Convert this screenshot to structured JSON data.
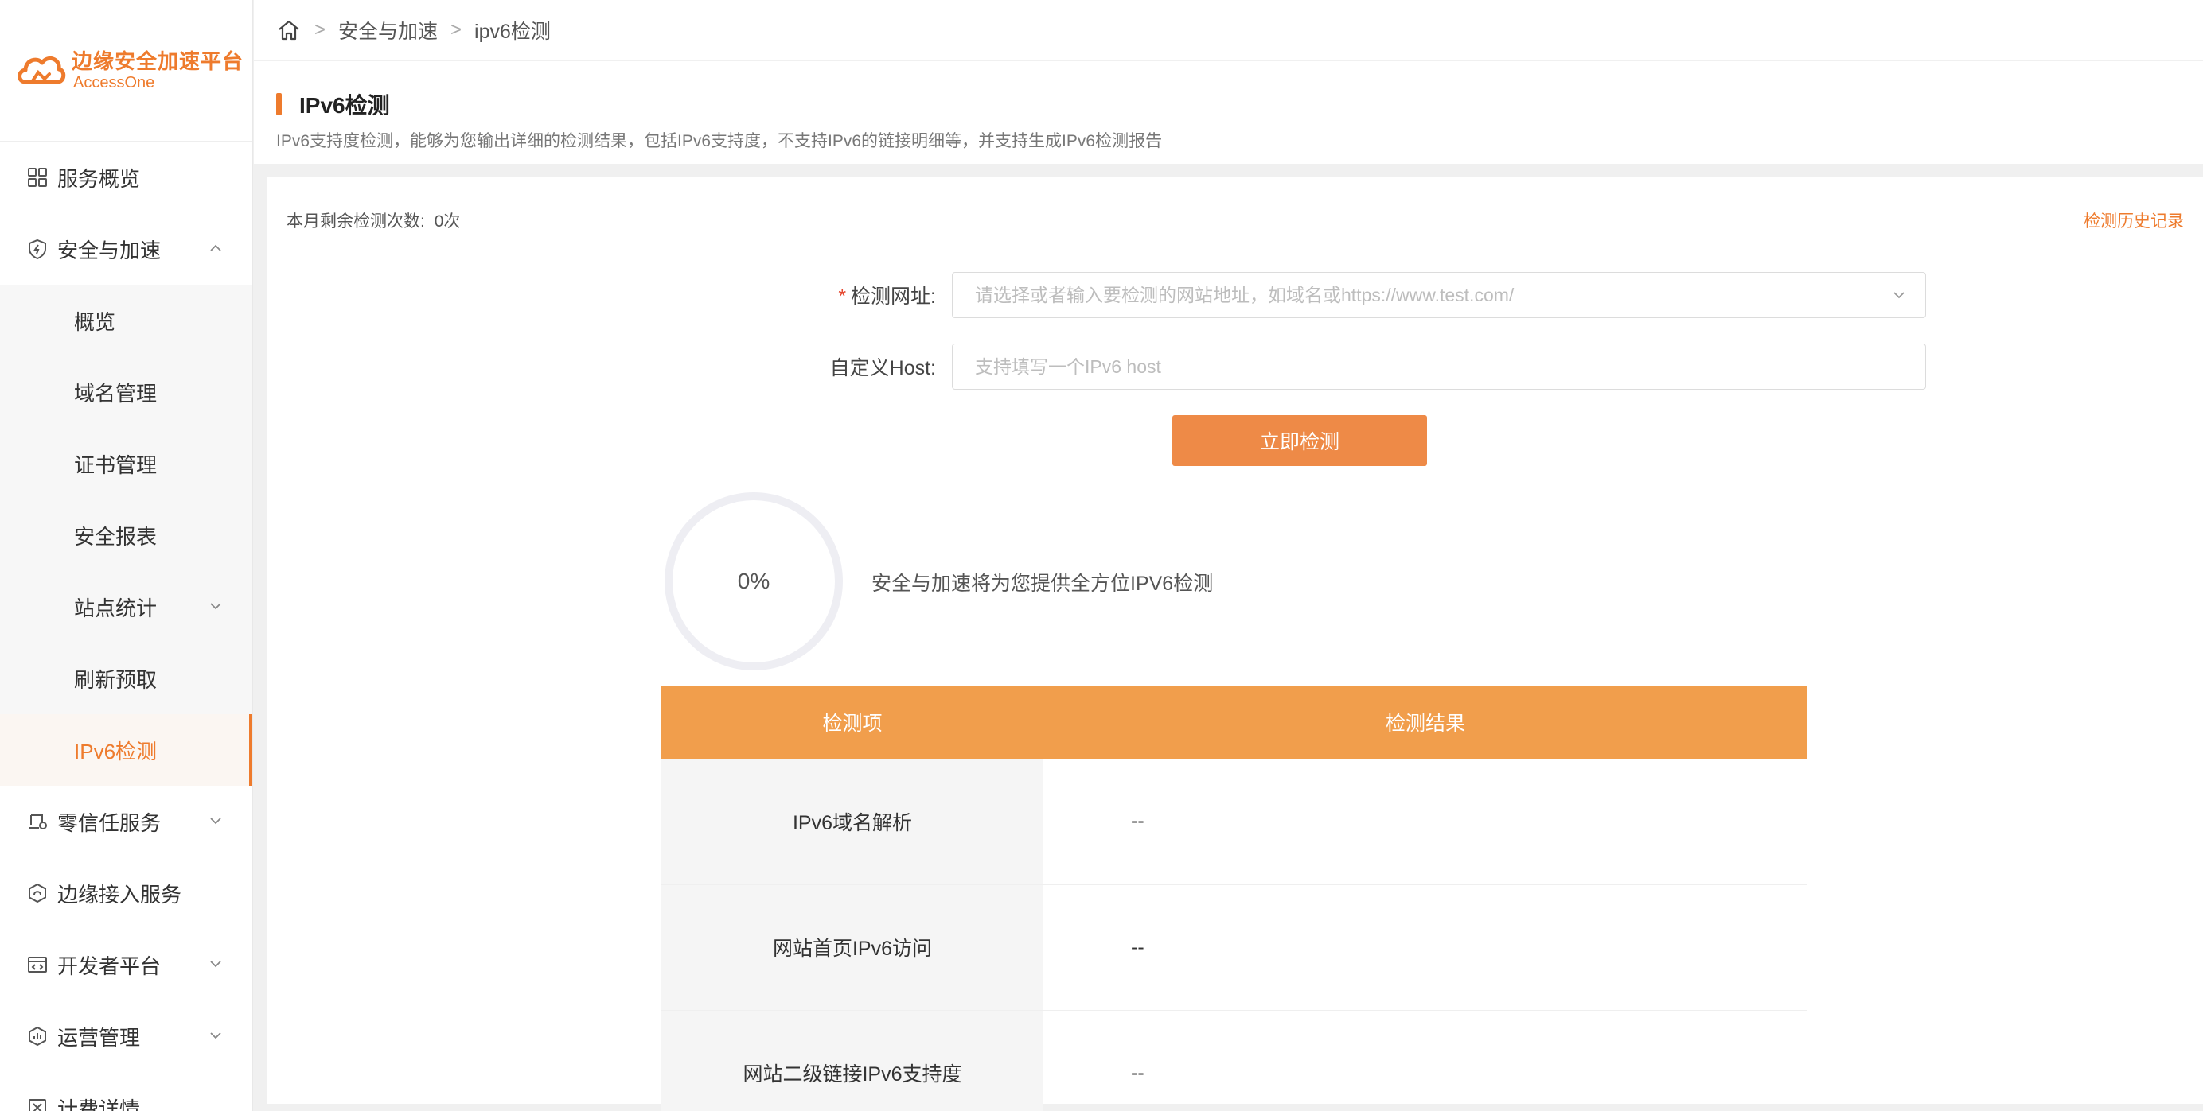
{
  "brand": {
    "name_cn": "边缘安全加速平台",
    "name_en": "AccessOne",
    "color": "#ee7b2d"
  },
  "sidebar": {
    "items": [
      {
        "label": "服务概览",
        "icon": "grid-icon"
      },
      {
        "label": "安全与加速",
        "icon": "shield-icon",
        "expanded": true
      },
      {
        "label": "零信任服务",
        "icon": "device-icon"
      },
      {
        "label": "边缘接入服务",
        "icon": "edge-icon"
      },
      {
        "label": "开发者平台",
        "icon": "code-icon"
      },
      {
        "label": "运营管理",
        "icon": "chart-icon"
      },
      {
        "label": "计费详情",
        "icon": "bill-icon"
      }
    ],
    "sub_items": [
      {
        "label": "概览"
      },
      {
        "label": "域名管理"
      },
      {
        "label": "证书管理"
      },
      {
        "label": "安全报表"
      },
      {
        "label": "站点统计"
      },
      {
        "label": "刷新预取"
      },
      {
        "label": "IPv6检测",
        "active": true
      }
    ]
  },
  "breadcrumb": [
    "安全与加速",
    "ipv6检测"
  ],
  "page": {
    "title": "IPv6检测",
    "description": "IPv6支持度检测，能够为您输出详细的检测结果，包括IPv6支持度，不支持IPv6的链接明细等，并支持生成IPv6检测报告"
  },
  "quota": {
    "label": "本月剩余检测次数:",
    "value": "0次"
  },
  "history_link": "检测历史记录",
  "form": {
    "url": {
      "label": "检测网址:",
      "required_mark": "*",
      "placeholder": "请选择或者输入要检测的网站地址，如域名或https://www.test.com/",
      "value": ""
    },
    "host": {
      "label": "自定义Host:",
      "placeholder": "支持填写一个IPv6 host",
      "value": ""
    },
    "submit_label": "立即检测"
  },
  "progress": {
    "percent": 0,
    "label": "0%",
    "message": "安全与加速将为您提供全方位IPV6检测"
  },
  "results": {
    "headers": [
      "检测项",
      "检测结果"
    ],
    "rows": [
      {
        "item": "IPv6域名解析",
        "result": "--"
      },
      {
        "item": "网站首页IPv6访问",
        "result": "--"
      },
      {
        "item": "网站二级链接IPv6支持度",
        "result": "--"
      }
    ]
  },
  "colors": {
    "accent": "#ee7b2d",
    "button": "#ee8a47",
    "table_header": "#f19e4c",
    "ring": "#eeeef3"
  }
}
